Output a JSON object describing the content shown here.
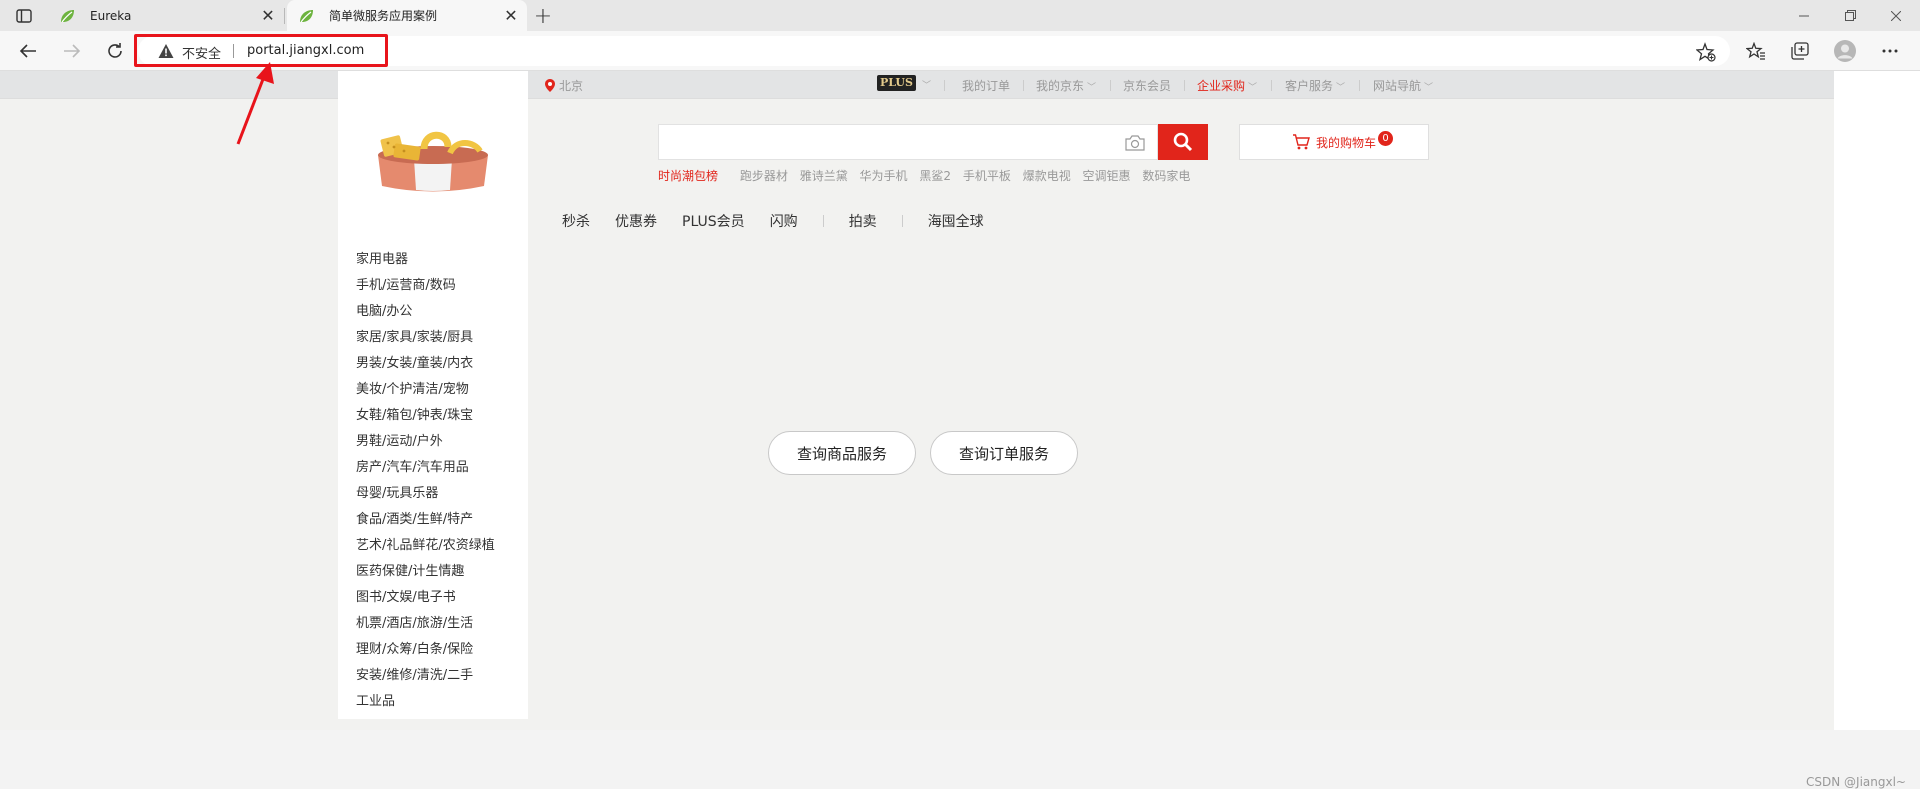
{
  "browser": {
    "tabs": [
      {
        "title": "Eureka",
        "active": false
      },
      {
        "title": "简单微服务应用案例",
        "active": true
      }
    ],
    "new_tab_label": "+",
    "address_bar": {
      "security_label": "不安全",
      "url": "portal.jiangxl.com"
    }
  },
  "page": {
    "shortcuts": {
      "location": "北京",
      "plus_badge": "PLUS",
      "items": [
        "我的订单",
        "我的京东",
        "京东会员",
        "企业采购",
        "客户服务",
        "网站导航"
      ]
    },
    "categories": [
      "家用电器",
      "手机/运营商/数码",
      "电脑/办公",
      "家居/家具/家装/厨具",
      "男装/女装/童装/内衣",
      "美妆/个护清洁/宠物",
      "女鞋/箱包/钟表/珠宝",
      "男鞋/运动/户外",
      "房产/汽车/汽车用品",
      "母婴/玩具乐器",
      "食品/酒类/生鲜/特产",
      "艺术/礼品鲜花/农资绿植",
      "医药保健/计生情趣",
      "图书/文娱/电子书",
      "机票/酒店/旅游/生活",
      "理财/众筹/白条/保险",
      "安装/维修/清洗/二手",
      "工业品"
    ],
    "search": {
      "hot_word": "时尚潮包榜",
      "hot_words": [
        "跑步器材",
        "雅诗兰黛",
        "华为手机",
        "黑鲨2",
        "手机平板",
        "爆款电视",
        "空调钜惠",
        "数码家电"
      ]
    },
    "cart": {
      "label": "我的购物车",
      "count": "0"
    },
    "nav": [
      "秒杀",
      "优惠券",
      "PLUS会员",
      "闪购",
      "拍卖",
      "海囤全球"
    ],
    "service_buttons": {
      "goods": "查询商品服务",
      "orders": "查询订单服务"
    },
    "watermark": "CSDN @Jiangxl~"
  }
}
